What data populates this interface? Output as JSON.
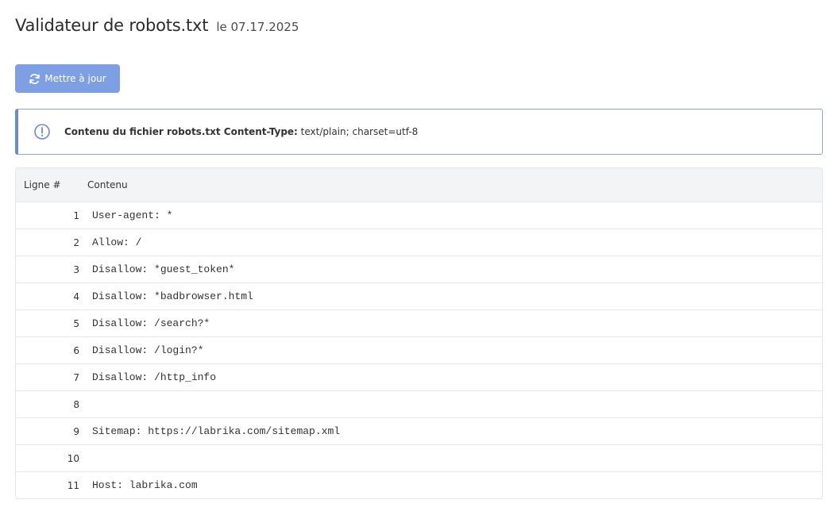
{
  "header": {
    "title": "Validateur de robots.txt",
    "date": "le 07.17.2025"
  },
  "toolbar": {
    "refresh_label": "Mettre à jour",
    "refresh_icon": "refresh-icon",
    "button_color": "#7f9fe5"
  },
  "info": {
    "icon": "info-icon",
    "label_bold": "Contenu du fichier robots.txt Content-Type:",
    "value": "text/plain; charset=utf-8",
    "accent_color": "#6b8ad6"
  },
  "table": {
    "headers": {
      "line": "Ligne #",
      "content": "Contenu"
    },
    "rows": [
      {
        "num": "1",
        "text": "User-agent: *"
      },
      {
        "num": "2",
        "text": "Allow: /"
      },
      {
        "num": "3",
        "text": "Disallow: *guest_token*"
      },
      {
        "num": "4",
        "text": "Disallow: *badbrowser.html"
      },
      {
        "num": "5",
        "text": "Disallow: /search?*"
      },
      {
        "num": "6",
        "text": "Disallow: /login?*"
      },
      {
        "num": "7",
        "text": "Disallow: /http_info"
      },
      {
        "num": "8",
        "text": ""
      },
      {
        "num": "9",
        "text": "Sitemap: https://labrika.com/sitemap.xml"
      },
      {
        "num": "10",
        "text": ""
      },
      {
        "num": "11",
        "text": "Host: labrika.com"
      }
    ]
  }
}
